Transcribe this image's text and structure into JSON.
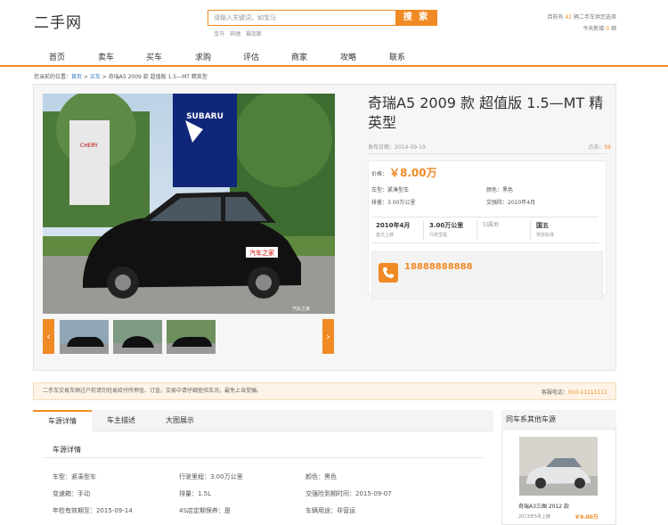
{
  "header": {
    "logo": "二手网",
    "search_placeholder": "请输入关键词，如宝马",
    "search_button": "搜 索",
    "hot_links": [
      "宝马",
      "奔驰",
      "福克斯"
    ],
    "stats_prefix": "目前有",
    "stats_count": "42",
    "stats_suffix": "辆二手车供您选择",
    "today_prefix": "今天新增",
    "today_count": "0",
    "today_suffix": "辆"
  },
  "nav": [
    "首页",
    "卖车",
    "买车",
    "求购",
    "评估",
    "商家",
    "攻略",
    "联系"
  ],
  "breadcrumb": {
    "prefix": "您当前的位置：",
    "home": "首页",
    "sep": " > ",
    "section": "买车",
    "current": "奇瑞A5 2009 款 超值版 1.5—MT 精英型"
  },
  "car": {
    "title": "奇瑞A5 2009 款 超值版 1.5—MT 精英型",
    "publish_label": "发布日期：",
    "publish_date": "2014-09-19",
    "views_label": "点击：",
    "views": "59",
    "price_label": "价格：",
    "price": "￥8.00万",
    "type_label": "车型：",
    "type": "紧凑型车",
    "color_label": "颜色：",
    "color": "黑色",
    "displacement_label": "排量：",
    "displacement": "3.00万公里",
    "insurance_label": "交强险：",
    "insurance": "2010年4月",
    "specs": [
      {
        "value": "2010年4月",
        "label": "首次上牌"
      },
      {
        "value": "3.00万公里",
        "label": "行驶里程"
      },
      {
        "value": "",
        "label": "归属地"
      },
      {
        "value": "国五",
        "label": "排放标准"
      }
    ],
    "phone": "18888888888",
    "photo_sign_top": "汽车之家",
    "photo_plate": "汽车之家",
    "photo_brand": "SUBARU",
    "photo_dealer": "CHERY"
  },
  "notice": {
    "text": "二手车交易车辆过户前请勿轻易给付所押金、订金，交易中请仔细查验车况，最免上当受骗。",
    "hotline_label": "客服电话：",
    "hotline": "010-11111111"
  },
  "tabs": [
    "车源详情",
    "车主描述",
    "大图展示"
  ],
  "detail": {
    "title": "车源详情",
    "rows": [
      [
        "车型：紧凑型车",
        "行驶里程：3.00万公里",
        "颜色：黑色"
      ],
      [
        "变速箱：手动",
        "排量：1.5L",
        "交强险到期时间：2015-09-07"
      ],
      [
        "年检有效期至：2015-09-14",
        "4S店定期保养：是",
        "车辆用途：非营运"
      ]
    ]
  },
  "sidebar": {
    "title": "同车系其他车源",
    "car_name": "奇瑞A3三厢 2012 款",
    "car_sub": "2013年5月上牌",
    "car_price": "￥9.00万"
  },
  "colors": {
    "accent": "#f08a24",
    "link": "#3b76c4"
  }
}
